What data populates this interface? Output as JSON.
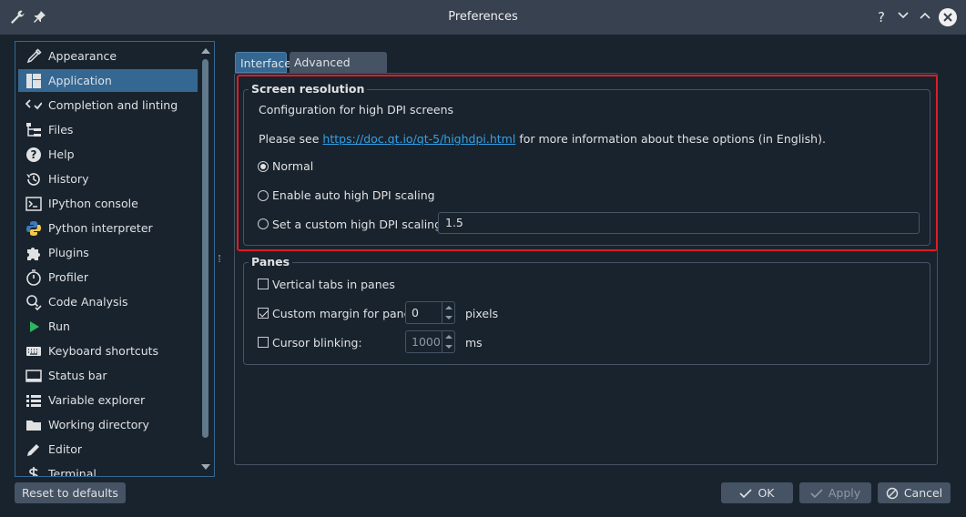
{
  "window": {
    "title": "Preferences",
    "controls": [
      "?",
      "minimize",
      "maximize",
      "close"
    ]
  },
  "sidebar": {
    "items": [
      {
        "label": "Appearance",
        "icon": "brush-icon"
      },
      {
        "label": "Application",
        "icon": "layout-icon",
        "selected": true
      },
      {
        "label": "Completion and linting",
        "icon": "code-check-icon"
      },
      {
        "label": "Files",
        "icon": "file-tree-icon"
      },
      {
        "label": "Help",
        "icon": "help-icon"
      },
      {
        "label": "History",
        "icon": "history-icon"
      },
      {
        "label": "IPython console",
        "icon": "console-icon"
      },
      {
        "label": "Python interpreter",
        "icon": "python-icon"
      },
      {
        "label": "Plugins",
        "icon": "puzzle-icon"
      },
      {
        "label": "Profiler",
        "icon": "stopwatch-icon"
      },
      {
        "label": "Code Analysis",
        "icon": "code-analysis-icon"
      },
      {
        "label": "Run",
        "icon": "play-icon"
      },
      {
        "label": "Keyboard shortcuts",
        "icon": "keyboard-icon"
      },
      {
        "label": "Status bar",
        "icon": "status-bar-icon"
      },
      {
        "label": "Variable explorer",
        "icon": "table-icon"
      },
      {
        "label": "Working directory",
        "icon": "folder-icon"
      },
      {
        "label": "Editor",
        "icon": "pencil-icon"
      },
      {
        "label": "Terminal",
        "icon": "dollar-icon"
      }
    ]
  },
  "tabs": [
    {
      "label": "Interface",
      "active": true
    },
    {
      "label": "Advanced settings",
      "active": false
    }
  ],
  "screen_resolution": {
    "title": "Screen resolution",
    "description": "Configuration for high DPI screens",
    "info_prefix": "Please see ",
    "info_link": "https://doc.qt.io/qt-5/highdpi.html",
    "info_suffix": " for more information about these options (in English).",
    "options": [
      {
        "label": "Normal",
        "selected": true
      },
      {
        "label": "Enable auto high DPI scaling",
        "selected": false
      },
      {
        "label": "Set a custom high DPI scaling",
        "selected": false
      }
    ],
    "custom_scaling_value": "1.5"
  },
  "panes": {
    "title": "Panes",
    "vertical_tabs": {
      "label": "Vertical tabs in panes",
      "checked": false
    },
    "custom_margin": {
      "label": "Custom margin for panes:",
      "checked": true,
      "value": "0",
      "unit": "pixels"
    },
    "cursor_blinking": {
      "label": "Cursor blinking:",
      "checked": false,
      "value": "1000",
      "unit": "ms"
    }
  },
  "buttons": {
    "reset": "Reset to defaults",
    "ok": "OK",
    "apply": "Apply",
    "cancel": "Cancel"
  },
  "colors": {
    "background": "#19232d",
    "titlebar": "#37414f",
    "selection": "#346792",
    "highlight_box": "#e01b24",
    "link": "#33a1e8"
  }
}
